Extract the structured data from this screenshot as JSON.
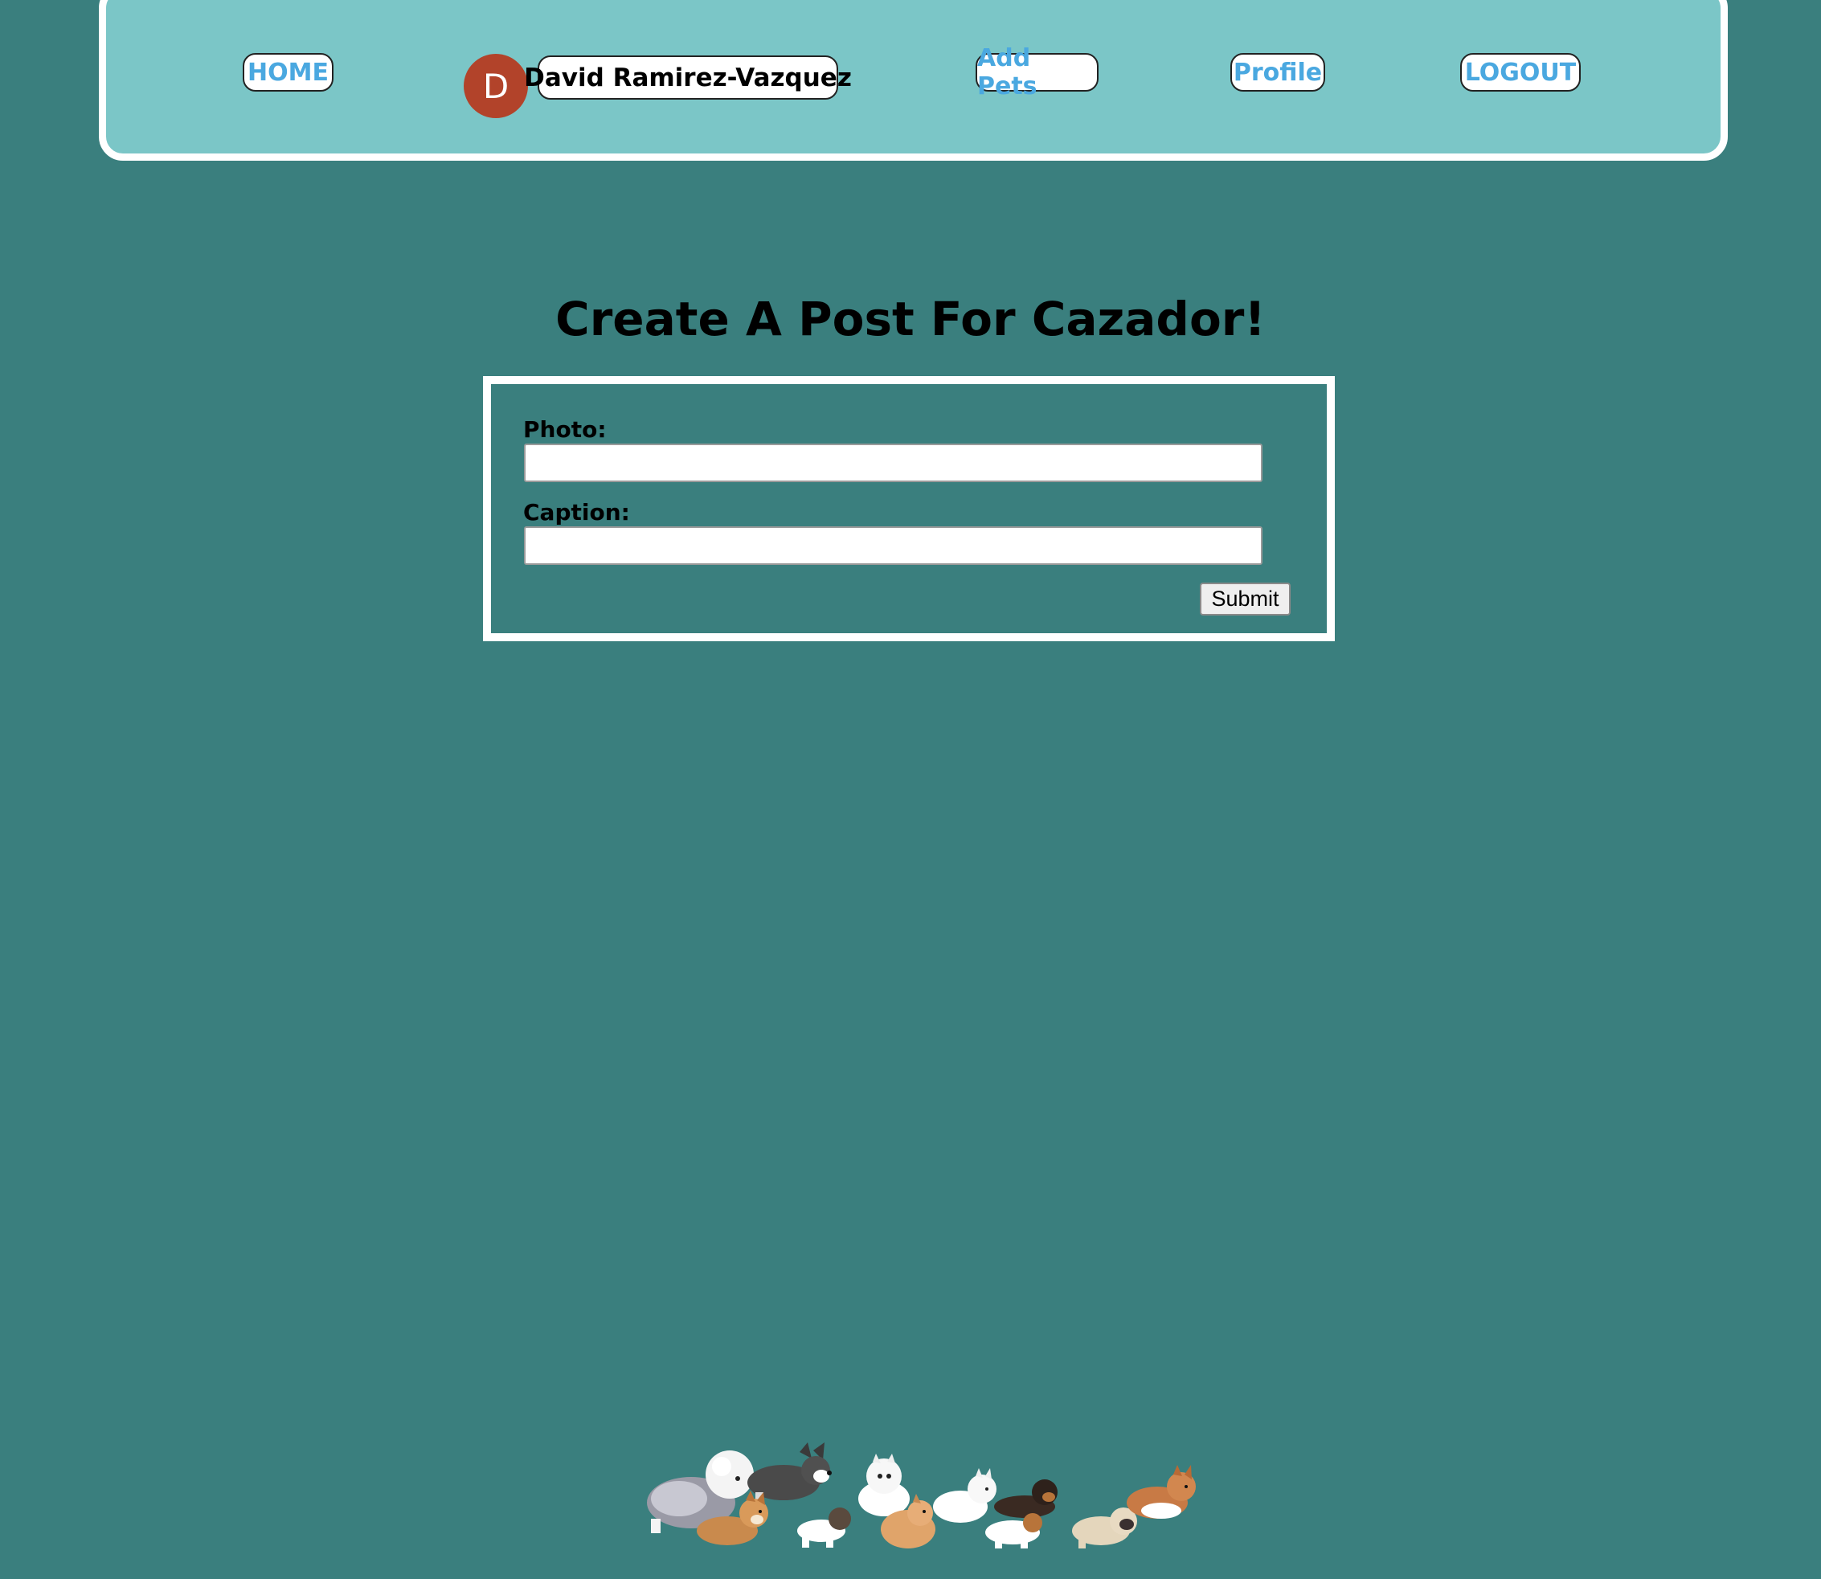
{
  "nav": {
    "home_label": "HOME",
    "avatar_initial": "D",
    "username": "David Ramirez-Vazquez",
    "add_pets_label": "Add Pets",
    "profile_label": "Profile",
    "logout_label": "LOGOUT"
  },
  "page": {
    "title": "Create A Post For Cazador!"
  },
  "form": {
    "photo_label": "Photo:",
    "photo_value": "",
    "caption_label": "Caption:",
    "caption_value": "",
    "submit_label": "Submit"
  },
  "colors": {
    "background": "#3a7f7e",
    "navbar": "#7bc6c7",
    "link": "#4aa8e0",
    "avatar": "#b2432a"
  },
  "footer": {
    "image_icon": "running-dogs-pixel-art"
  }
}
